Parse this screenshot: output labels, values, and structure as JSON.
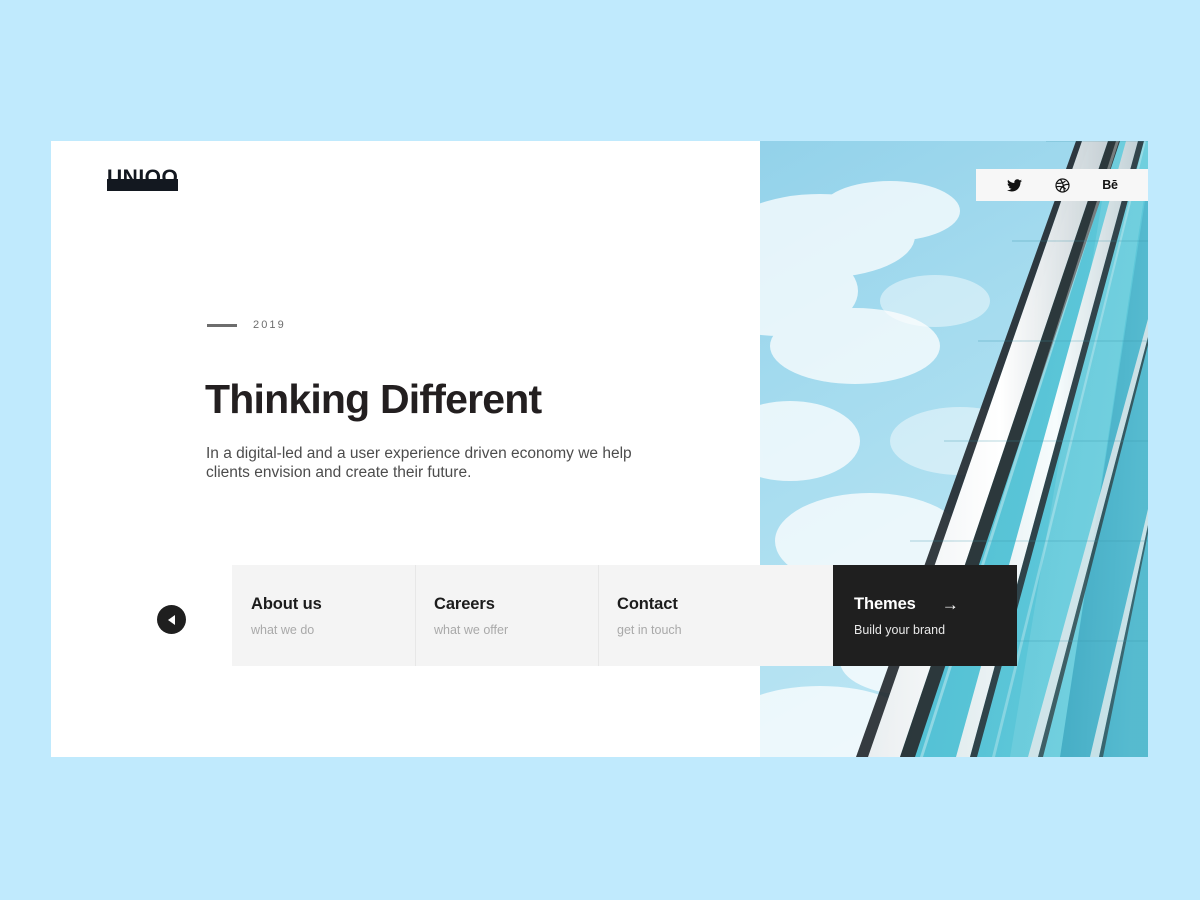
{
  "theme": {
    "page_background": "#c0eafd",
    "panel_background": "#ffffff",
    "card_background": "#f4f4f4",
    "accent_dark": "#1f1f1f",
    "title_color": "#231f20",
    "muted_color": "#a9a9a9",
    "body_color": "#4c4c4c"
  },
  "brand": {
    "logo_text": "UNIQO"
  },
  "social": {
    "items": [
      {
        "name": "twitter",
        "label": ""
      },
      {
        "name": "dribbble",
        "label": ""
      },
      {
        "name": "behance",
        "label": "Bē"
      }
    ]
  },
  "hero": {
    "eyebrow_year": "2019",
    "headline": "Thinking Different",
    "paragraph": "In a digital-led and a user experience driven economy we help clients envision and create their future."
  },
  "carousel": {
    "prev_label": "Previous"
  },
  "cards": [
    {
      "title": "About us",
      "subtitle": "what we do"
    },
    {
      "title": "Careers",
      "subtitle": "what we offer"
    },
    {
      "title": "Contact",
      "subtitle": "get in touch"
    }
  ],
  "featured_card": {
    "title": "Themes",
    "subtitle": "Build your brand",
    "arrow": "→"
  }
}
